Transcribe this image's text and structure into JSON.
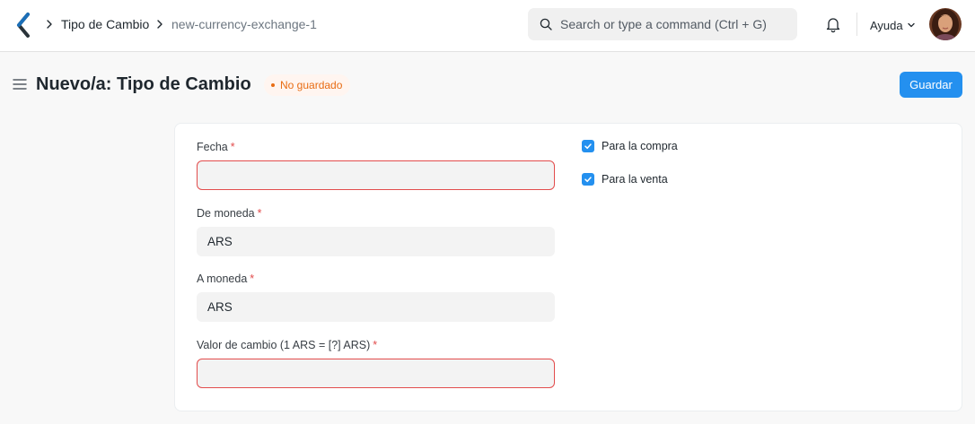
{
  "navbar": {
    "breadcrumbs": [
      "Tipo de Cambio",
      "new-currency-exchange-1"
    ],
    "search_placeholder": "Search or type a command (Ctrl + G)",
    "help_label": "Ayuda"
  },
  "header": {
    "title": "Nuevo/a: Tipo de Cambio",
    "status": "No guardado",
    "save_label": "Guardar"
  },
  "form": {
    "fields": [
      {
        "label": "Fecha",
        "required": "*",
        "value": "",
        "invalid": true
      },
      {
        "label": "De moneda",
        "required": "*",
        "value": "ARS",
        "invalid": false
      },
      {
        "label": "A moneda",
        "required": "*",
        "value": "ARS",
        "invalid": false
      },
      {
        "label": "Valor de cambio (1 ARS = [?] ARS)",
        "required": "*",
        "value": "",
        "invalid": true
      }
    ],
    "checkboxes": [
      {
        "label": "Para la compra",
        "checked": true
      },
      {
        "label": "Para la venta",
        "checked": true
      }
    ]
  },
  "colors": {
    "primary": "#2490ef",
    "required": "#e24c4c",
    "status_orange": "#e86c13"
  },
  "icons": {
    "logo": "frappe-logo-icon",
    "search": "search-icon",
    "notifications": "bell-icon",
    "menu": "hamburger-icon",
    "check": "check-icon"
  }
}
